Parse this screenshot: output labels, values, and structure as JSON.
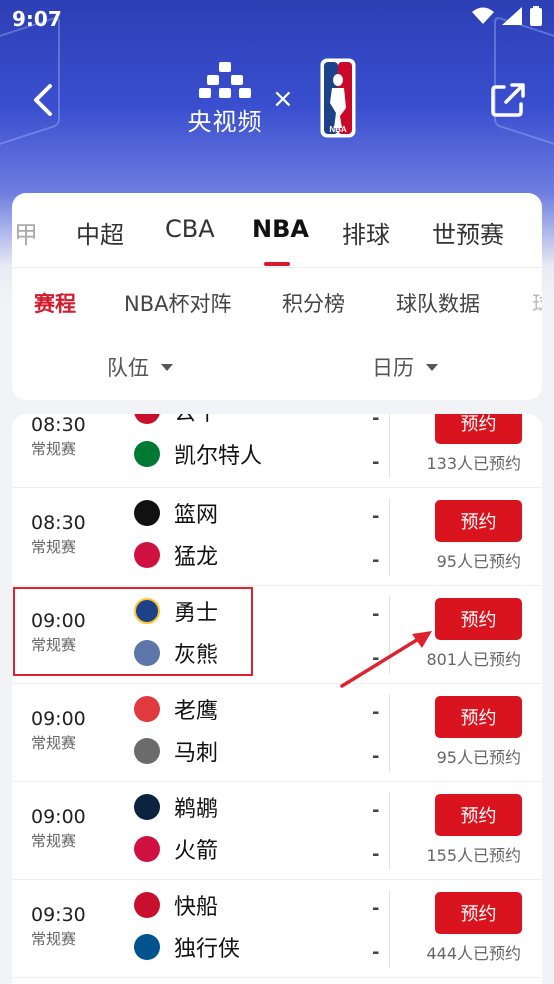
{
  "status_bar": {
    "time": "9:07"
  },
  "header": {
    "brand_name": "央视频",
    "times": "×",
    "nba_logo_text": "NBA"
  },
  "sport_tabs": [
    "甲",
    "中超",
    "CBA",
    "NBA",
    "排球",
    "世预赛"
  ],
  "sub_tabs": [
    "赛程",
    "NBA杯对阵",
    "积分榜",
    "球队数据",
    "球"
  ],
  "filters": {
    "team": "队伍",
    "calendar": "日历"
  },
  "matches": [
    {
      "time": "08:30",
      "type": "常规赛",
      "home": "公牛",
      "away": "凯尔特人",
      "home_score": "-",
      "away_score": "-",
      "button": "预约",
      "count": "133人已预约",
      "home_color": "#c8102e",
      "away_color": "#007a33"
    },
    {
      "time": "08:30",
      "type": "常规赛",
      "home": "篮网",
      "away": "猛龙",
      "home_score": "-",
      "away_score": "-",
      "button": "预约",
      "count": "95人已预约",
      "home_color": "#111111",
      "away_color": "#ce1141"
    },
    {
      "time": "09:00",
      "type": "常规赛",
      "home": "勇士",
      "away": "灰熊",
      "home_score": "-",
      "away_score": "-",
      "button": "预约",
      "count": "801人已预约",
      "home_color": "#1d428a",
      "away_color": "#5d76a9"
    },
    {
      "time": "09:00",
      "type": "常规赛",
      "home": "老鹰",
      "away": "马刺",
      "home_score": "-",
      "away_score": "-",
      "button": "预约",
      "count": "95人已预约",
      "home_color": "#e03a3e",
      "away_color": "#6b6b6b"
    },
    {
      "time": "09:00",
      "type": "常规赛",
      "home": "鹈鹕",
      "away": "火箭",
      "home_score": "-",
      "away_score": "-",
      "button": "预约",
      "count": "155人已预约",
      "home_color": "#0c2340",
      "away_color": "#ce1141"
    },
    {
      "time": "09:30",
      "type": "常规赛",
      "home": "快船",
      "away": "独行侠",
      "home_score": "-",
      "away_score": "-",
      "button": "预约",
      "count": "444人已预约",
      "home_color": "#c8102e",
      "away_color": "#00538c"
    }
  ],
  "colors": {
    "accent": "#d41a2c",
    "button": "#d9141f",
    "header_blue": "#2c3fb5"
  }
}
